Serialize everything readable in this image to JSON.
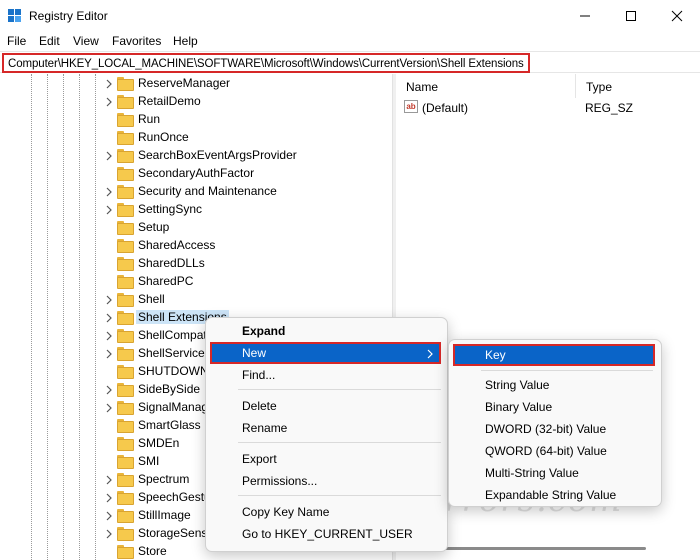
{
  "window": {
    "title": "Registry Editor",
    "minimize_icon": "minimize-icon",
    "maximize_icon": "maximize-icon",
    "close_icon": "close-icon"
  },
  "menubar": {
    "items": [
      "File",
      "Edit",
      "View",
      "Favorites",
      "Help"
    ]
  },
  "address": {
    "path": "Computer\\HKEY_LOCAL_MACHINE\\SOFTWARE\\Microsoft\\Windows\\CurrentVersion\\Shell Extensions"
  },
  "tree": {
    "items": [
      "ReserveManager",
      "RetailDemo",
      "Run",
      "RunOnce",
      "SearchBoxEventArgsProvider",
      "SecondaryAuthFactor",
      "Security and Maintenance",
      "SettingSync",
      "Setup",
      "SharedAccess",
      "SharedDLLs",
      "SharedPC",
      "Shell",
      "Shell Extensions",
      "ShellCompat",
      "ShellServiceO",
      "SHUTDOWN",
      "SideBySide",
      "SignalManag",
      "SmartGlass",
      "SMDEn",
      "SMI",
      "Spectrum",
      "SpeechGestu",
      "StillImage",
      "StorageSense",
      "Store"
    ],
    "selected": "Shell Extensions"
  },
  "values": {
    "columns": {
      "name": "Name",
      "type": "Type"
    },
    "rows": [
      {
        "name": "(Default)",
        "type": "REG_SZ",
        "icon": "string-value-icon"
      }
    ]
  },
  "context_menu": {
    "expand": "Expand",
    "new": "New",
    "find": "Find...",
    "delete": "Delete",
    "rename": "Rename",
    "export": "Export",
    "permissions": "Permissions...",
    "copy_key_name": "Copy Key Name",
    "goto_hkcu": "Go to HKEY_CURRENT_USER"
  },
  "submenu": {
    "key": "Key",
    "string_value": "String Value",
    "binary_value": "Binary Value",
    "dword_value": "DWORD (32-bit) Value",
    "qword_value": "QWORD (64-bit) Value",
    "multi_string_value": "Multi-String Value",
    "expandable_string_value": "Expandable String Value"
  },
  "watermark": "AvoidErrors.com",
  "colors": {
    "accent": "#0a64c8",
    "highlight_box": "#d62828",
    "selection": "#cce4f7",
    "folder": "#f6c94c"
  }
}
